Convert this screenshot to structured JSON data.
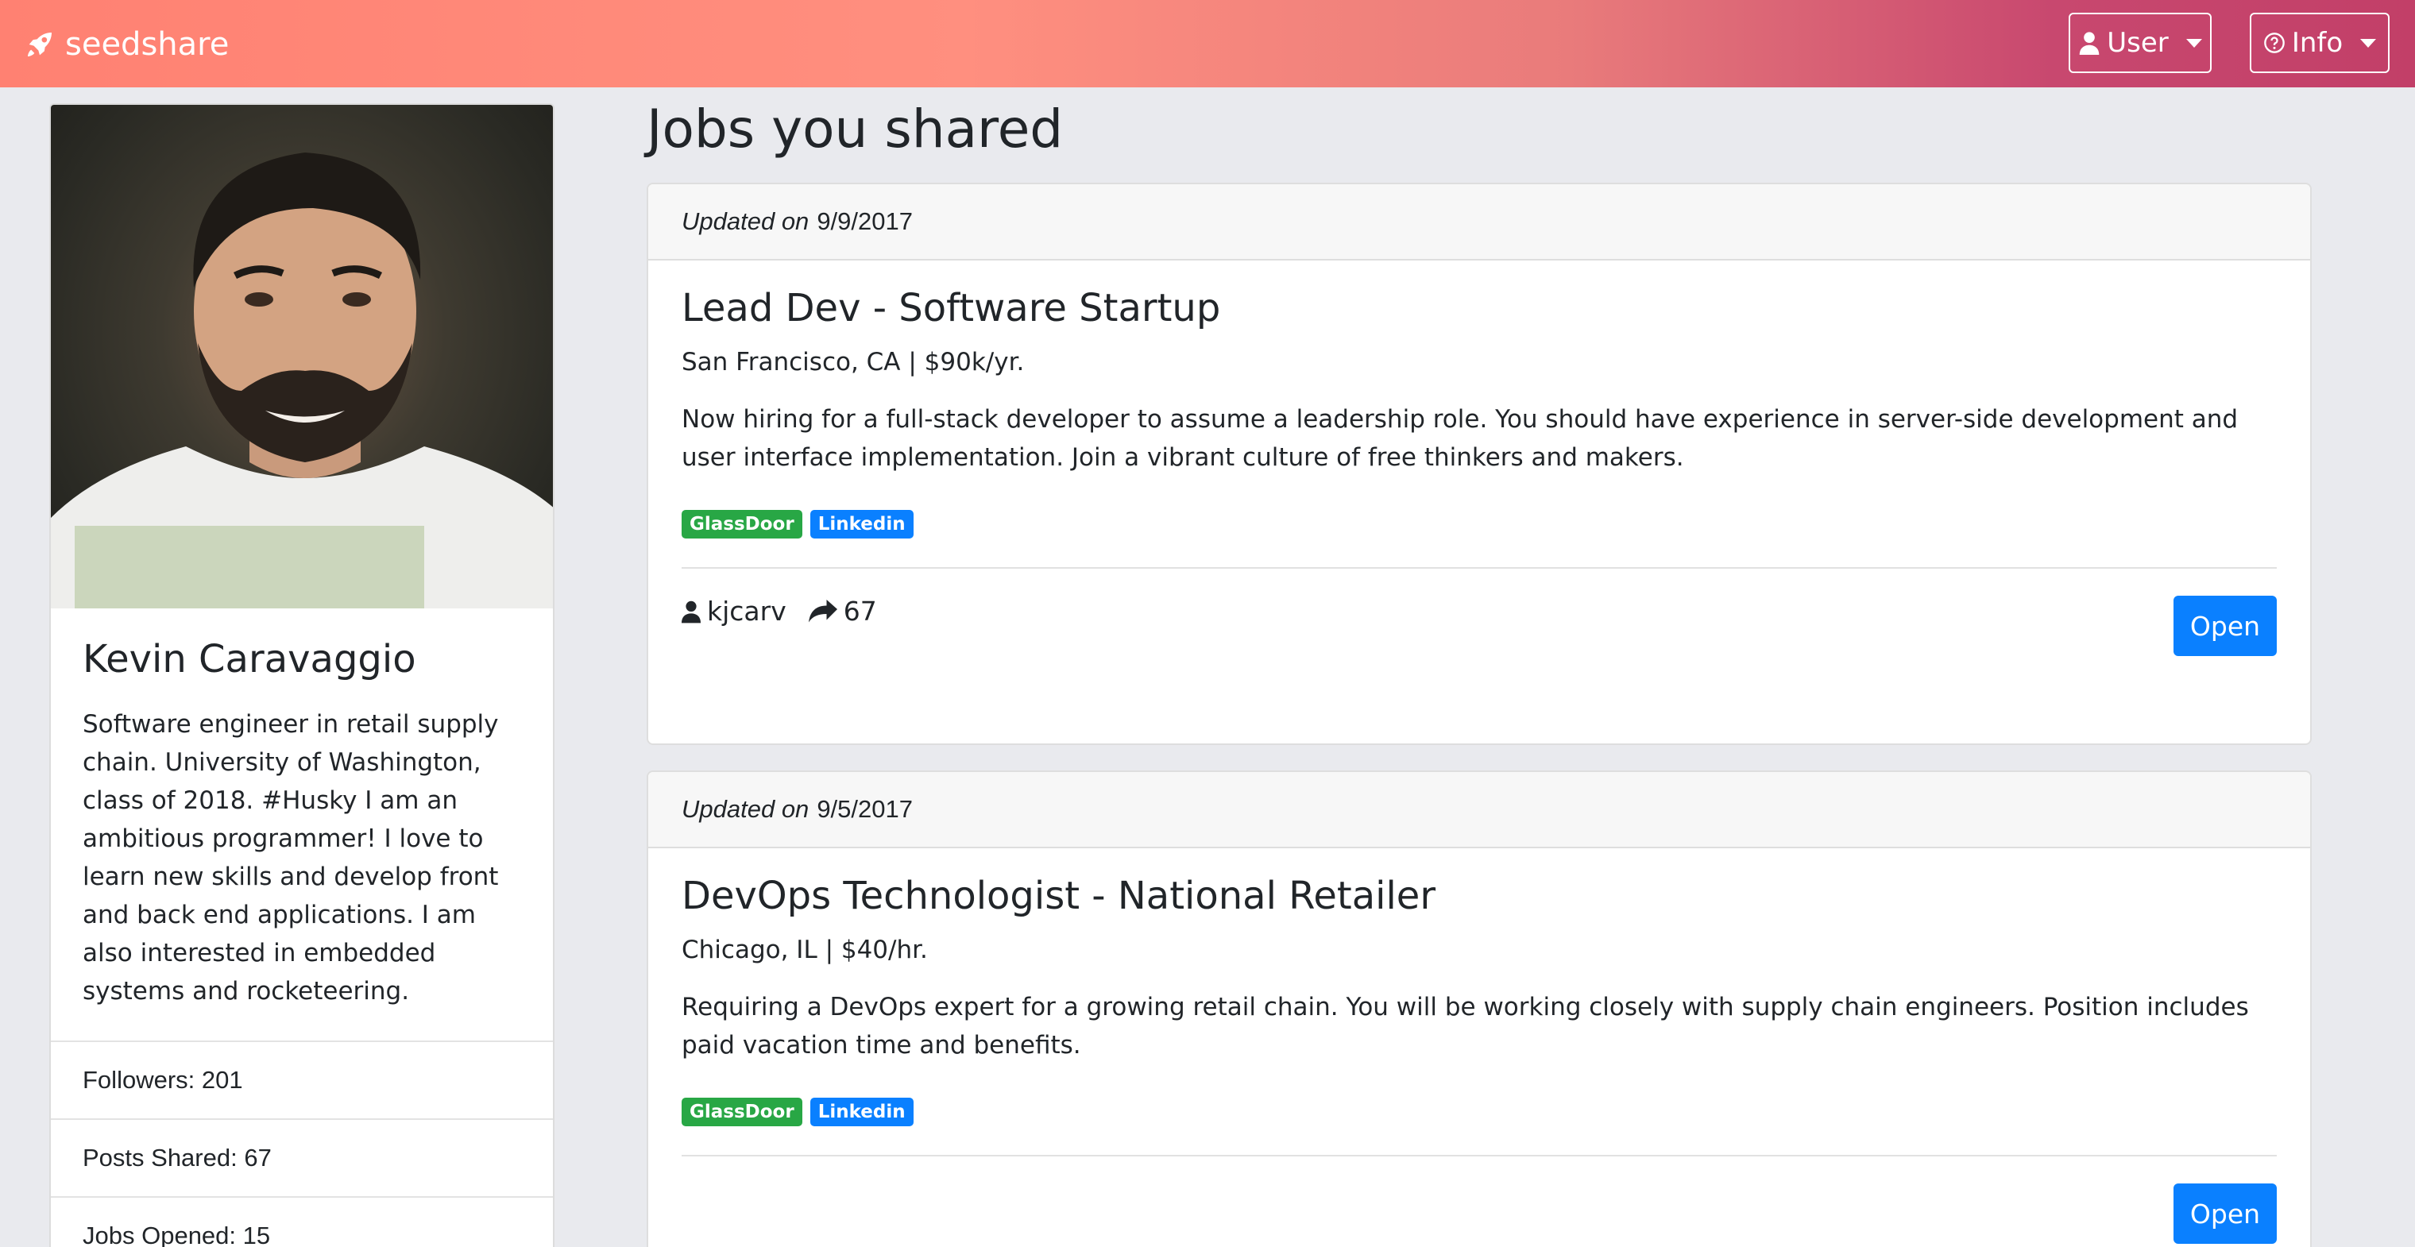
{
  "app": {
    "brand": "seedshare"
  },
  "nav": {
    "user_label": "User",
    "info_label": "Info"
  },
  "profile": {
    "name": "Kevin Caravaggio",
    "bio": "Software engineer in retail supply chain. University of Washington, class of 2018. #Husky I am an ambitious programmer! I love to learn new skills and develop front and back end applications. I am also interested in embedded systems and rocketeering.",
    "stats": [
      "Followers: 201",
      "Posts Shared: 67",
      "Jobs Opened: 15"
    ]
  },
  "main": {
    "title": "Jobs you shared",
    "updated_prefix": "Updated on",
    "open_label": "Open",
    "jobs": [
      {
        "date": "9/9/2017",
        "title": "Lead Dev - Software Startup",
        "meta": "San Francisco, CA | $90k/yr.",
        "description": "Now hiring for a full-stack developer to assume a leadership role. You should have experience in server-side development and user interface implementation. Join a vibrant culture of free thinkers and makers.",
        "badges": [
          "GlassDoor",
          "Linkedin"
        ],
        "user": "kjcarv",
        "shares": "67"
      },
      {
        "date": "9/5/2017",
        "title": "DevOps Technologist - National Retailer",
        "meta": "Chicago, IL | $40/hr.",
        "description": "Requiring a DevOps expert for a growing retail chain. You will be working closely with supply chain engineers. Position includes paid vacation time and benefits.",
        "badges": [
          "GlassDoor",
          "Linkedin"
        ]
      }
    ]
  },
  "colors": {
    "badge_glassdoor": "#28a745",
    "badge_linkedin": "#0a80ff",
    "primary": "#0a80ff"
  }
}
